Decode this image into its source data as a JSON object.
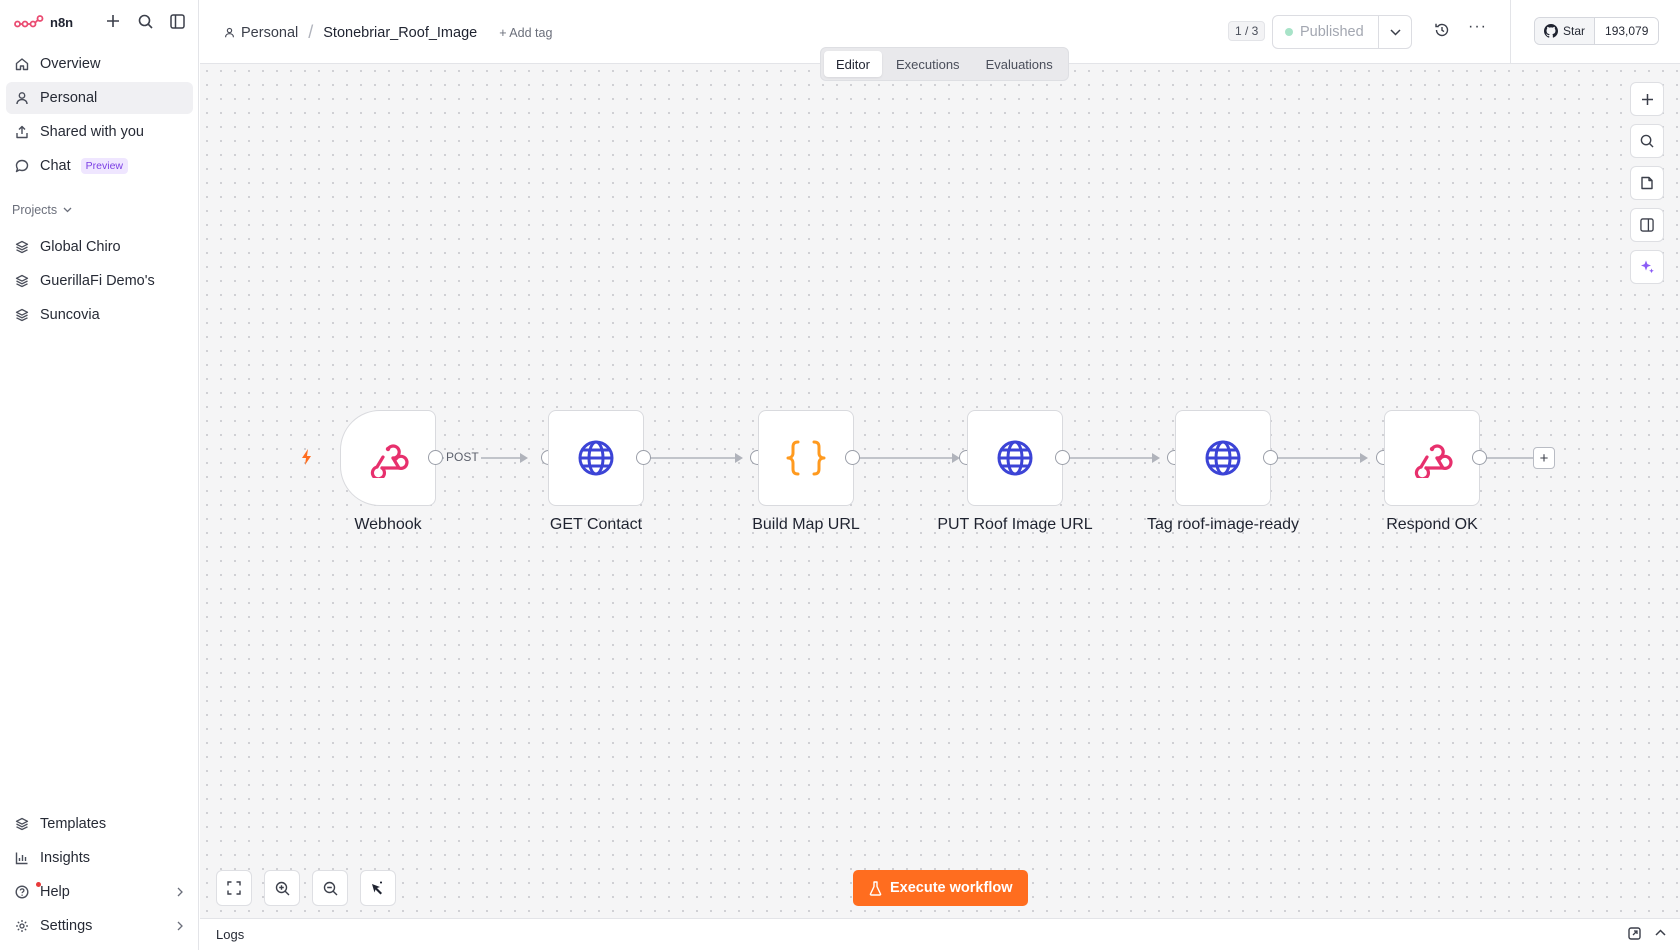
{
  "brand": {
    "name": "n8n"
  },
  "sidebar": {
    "items": [
      {
        "label": "Overview",
        "icon": "home-icon"
      },
      {
        "label": "Personal",
        "icon": "user-icon"
      },
      {
        "label": "Shared with you",
        "icon": "share-icon"
      },
      {
        "label": "Chat",
        "icon": "chat-icon",
        "badge": "Preview"
      }
    ],
    "projects_label": "Projects",
    "projects": [
      "Global Chiro",
      "GuerillaFi Demo's",
      "Suncovia"
    ],
    "bottom": [
      {
        "label": "Templates",
        "icon": "templates-icon"
      },
      {
        "label": "Insights",
        "icon": "insights-icon"
      },
      {
        "label": "Help",
        "icon": "help-icon"
      },
      {
        "label": "Settings",
        "icon": "settings-icon"
      }
    ]
  },
  "header": {
    "crumb_project": "Personal",
    "workflow_name": "Stonebriar_Roof_Image",
    "add_tag": "+ Add tag",
    "versions": "1 / 3",
    "publish_label": "Published",
    "github_star": "Star",
    "github_count": "193,079"
  },
  "tabs": [
    "Editor",
    "Executions",
    "Evaluations"
  ],
  "active_tab": "Editor",
  "workflow": {
    "nodes": [
      {
        "label": "Webhook",
        "type": "webhook",
        "trigger": true
      },
      {
        "label": "GET Contact",
        "type": "http"
      },
      {
        "label": "Build Map URL",
        "type": "code"
      },
      {
        "label": "PUT Roof Image URL",
        "type": "http"
      },
      {
        "label": "Tag roof-image-ready",
        "type": "http"
      },
      {
        "label": "Respond OK",
        "type": "webhook"
      }
    ],
    "first_edge_label": "POST"
  },
  "execute_button": "Execute workflow",
  "logs_label": "Logs",
  "colors": {
    "accent": "#ff6d1f",
    "webhook": "#e7306d",
    "http": "#3c44d6",
    "code": "#ff9a1f",
    "preview_badge": "#7b3fe4"
  }
}
